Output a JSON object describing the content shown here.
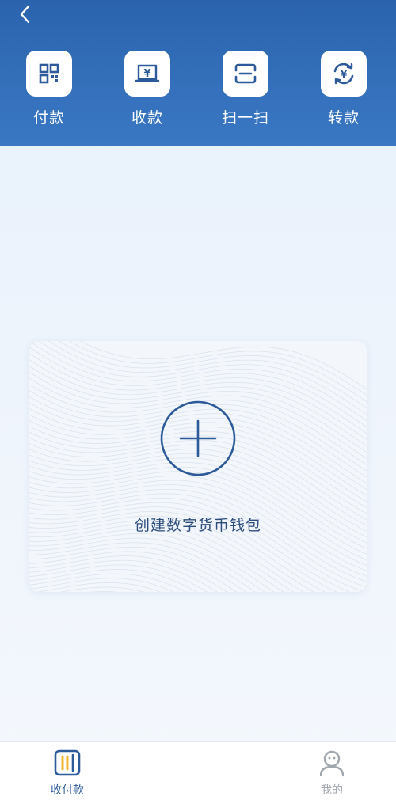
{
  "colors": {
    "header_bg": "#2b63ad",
    "accent_blue": "#2c5a9a",
    "accent_yellow": "#f2b632",
    "tab_inactive": "#a0a6ad"
  },
  "header": {
    "back_icon": "chevron-left-icon",
    "actions": [
      {
        "label": "付款",
        "icon": "qr-code-icon"
      },
      {
        "label": "收款",
        "icon": "receive-yuan-icon"
      },
      {
        "label": "扫一扫",
        "icon": "scan-icon"
      },
      {
        "label": "转款",
        "icon": "transfer-yuan-icon"
      }
    ]
  },
  "card": {
    "label": "创建数字货币钱包",
    "icon": "plus-circle-icon"
  },
  "tabbar": {
    "tabs": [
      {
        "label": "收付款",
        "icon": "wallet-icon",
        "active": true
      },
      {
        "label": "我的",
        "icon": "profile-icon",
        "active": false
      }
    ]
  }
}
